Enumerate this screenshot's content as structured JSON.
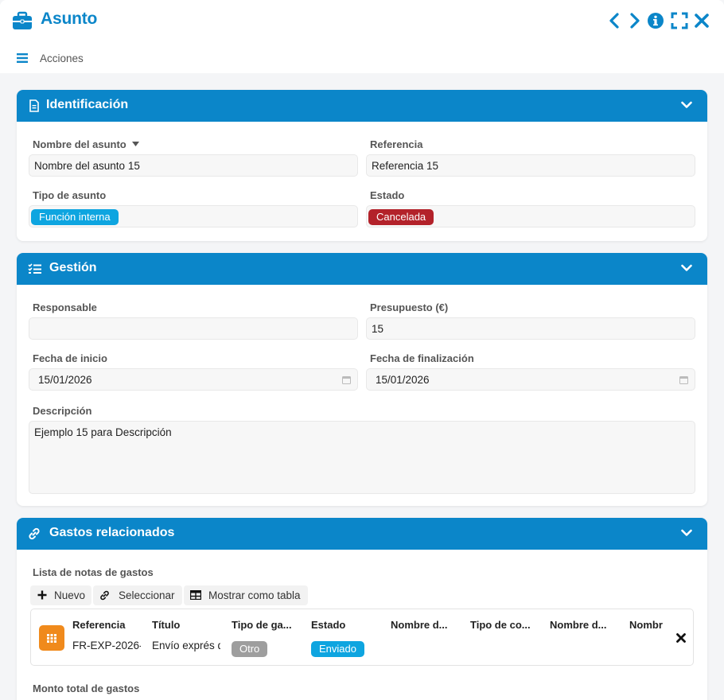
{
  "window": {
    "title": "Asunto",
    "actions_label": "Acciones",
    "colors": {
      "accent": "#0b86c9",
      "panel_header": "#0b86c9"
    }
  },
  "sections": {
    "identificacion": {
      "title": "Identificación",
      "nombre_label": "Nombre del asunto",
      "nombre_value": "Nombre del asunto 15",
      "referencia_label": "Referencia",
      "referencia_value": "Referencia 15",
      "tipo_label": "Tipo de asunto",
      "tipo_value": "Función interna",
      "tipo_color": "#0ea5e0",
      "estado_label": "Estado",
      "estado_value": "Cancelada",
      "estado_color": "#b3222a"
    },
    "gestion": {
      "title": "Gestión",
      "responsable_label": "Responsable",
      "responsable_value": "",
      "presupuesto_label": "Presupuesto (€)",
      "presupuesto_value": "15",
      "inicio_label": "Fecha de inicio",
      "inicio_value": "15/01/2026",
      "fin_label": "Fecha de finalización",
      "fin_value": "15/01/2026",
      "descripcion_label": "Descripción",
      "descripcion_value": "Ejemplo 15 para Descripción"
    },
    "gastos": {
      "title": "Gastos relacionados",
      "list_label": "Lista de notas de gastos",
      "btn_nuevo": "Nuevo",
      "btn_seleccionar": "Seleccionar",
      "btn_tabla": "Mostrar como tabla",
      "columns": [
        "Referencia",
        "Título",
        "Tipo de ga...",
        "Estado",
        "Nombre d...",
        "Tipo de co...",
        "Nombre d...",
        "Nombr"
      ],
      "rows": [
        {
          "referencia": "FR-EXP-2026-",
          "titulo": "Envío exprés d",
          "tipo": "Otro",
          "tipo_color": "#9e9e9e",
          "estado": "Enviado",
          "estado_color": "#0ea5e0"
        }
      ],
      "monto_label": "Monto total de gastos"
    }
  }
}
